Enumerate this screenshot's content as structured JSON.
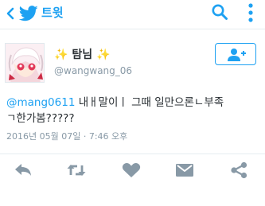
{
  "header": {
    "title": "트윗",
    "icons": [
      "back-arrow-icon",
      "twitter-bird-icon",
      "search-icon",
      "more-vertical-icon"
    ],
    "accent": "#1da1f2"
  },
  "tweet": {
    "display_name": "탐님",
    "name_decoration": "✨",
    "handle": "@wangwang_06",
    "mention": "@mang0611",
    "text_line1": " 내ㅐ말이ㅣ  그때 일만으론ㄴ부족",
    "text_line2": "ㄱ한가봄?????",
    "timestamp": "2016년 05월 07일 · 7:46 오후"
  },
  "actions": {
    "icons": [
      "reply-icon",
      "retweet-icon",
      "like-icon",
      "direct-message-icon",
      "share-icon"
    ],
    "icon_color": "#8899a6"
  }
}
